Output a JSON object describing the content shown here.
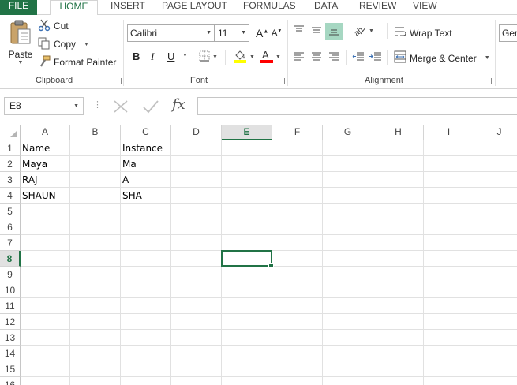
{
  "tabs": [
    "FILE",
    "HOME",
    "INSERT",
    "PAGE LAYOUT",
    "FORMULAS",
    "DATA",
    "REVIEW",
    "VIEW"
  ],
  "clipboard": {
    "paste": "Paste",
    "cut": "Cut",
    "copy": "Copy",
    "format_painter": "Format Painter",
    "group_label": "Clipboard"
  },
  "font": {
    "name": "Calibri",
    "size": "11",
    "bold": "B",
    "italic": "I",
    "underline": "U",
    "group_label": "Font"
  },
  "alignment": {
    "wrap_text": "Wrap Text",
    "merge_center": "Merge & Center",
    "group_label": "Alignment"
  },
  "number": {
    "format": "Ger"
  },
  "formula_bar": {
    "name_box": "E8",
    "fx": "fx",
    "value": ""
  },
  "sheet": {
    "columns": [
      "A",
      "B",
      "C",
      "D",
      "E",
      "F",
      "G",
      "H",
      "I",
      "J"
    ],
    "rows": [
      "1",
      "2",
      "3",
      "4",
      "5",
      "6",
      "7",
      "8",
      "9",
      "10",
      "11",
      "12",
      "13",
      "14",
      "15",
      "16"
    ],
    "selected_cell": "E8",
    "cells": {
      "A1": "Name",
      "C1": "Instance",
      "A2": "Maya",
      "C2": "Ma",
      "A3": "RAJ",
      "C3": "A",
      "A4": "SHAUN",
      "C4": "SHA"
    }
  },
  "colors": {
    "accent": "#217346",
    "header_selected_bg": "#e1e1e1",
    "gridline": "#e1e1e1",
    "fill_highlight": "#ffff00",
    "font_color_red": "#ff0000"
  },
  "icons": [
    "scissors-icon",
    "copy-icon",
    "paintbrush-icon",
    "clipboard-icon",
    "fill-color-icon",
    "font-color-icon",
    "borders-icon",
    "wrap-text-icon",
    "merge-icon",
    "fx-icon",
    "cancel-icon",
    "enter-icon"
  ]
}
